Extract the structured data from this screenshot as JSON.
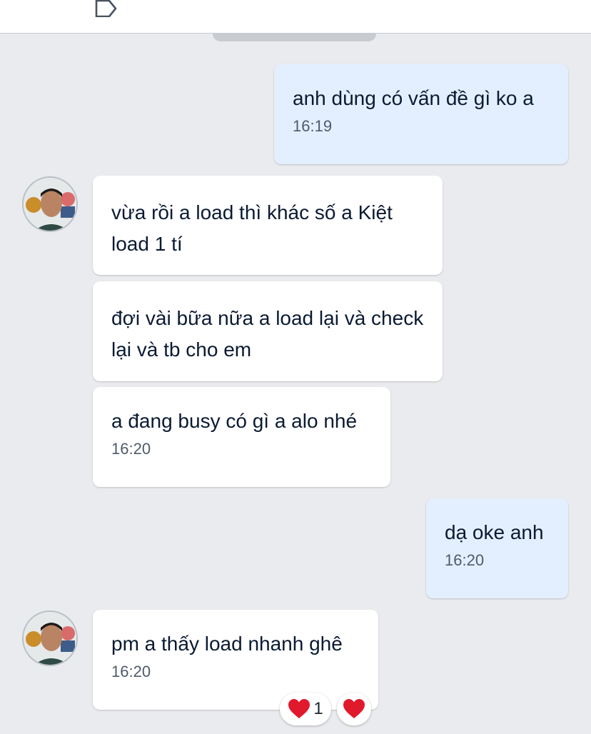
{
  "header": {
    "icon": "tag-icon"
  },
  "messages": [
    {
      "from": "me",
      "text": "anh dùng có vấn đề gì ko a",
      "time": "16:19"
    },
    {
      "from": "them",
      "text": "vừa rồi a load thì khác số a Kiệt load 1 tí"
    },
    {
      "from": "them",
      "text": "đợi vài bữa nữa a load lại và check lại và tb cho em"
    },
    {
      "from": "them",
      "text": "a đang busy có gì a alo nhé",
      "time": "16:20"
    },
    {
      "from": "me",
      "text": "dạ oke anh",
      "time": "16:20"
    },
    {
      "from": "them",
      "text": "pm a thấy load nhanh ghê",
      "time": "16:20"
    }
  ],
  "reactions": {
    "heart_count": "1",
    "icon": "heart-icon",
    "add_icon": "heart-icon"
  },
  "colors": {
    "my_bubble": "#e3effe",
    "their_bubble": "#ffffff",
    "background": "#e9ebee",
    "heart": "#e0192c"
  }
}
